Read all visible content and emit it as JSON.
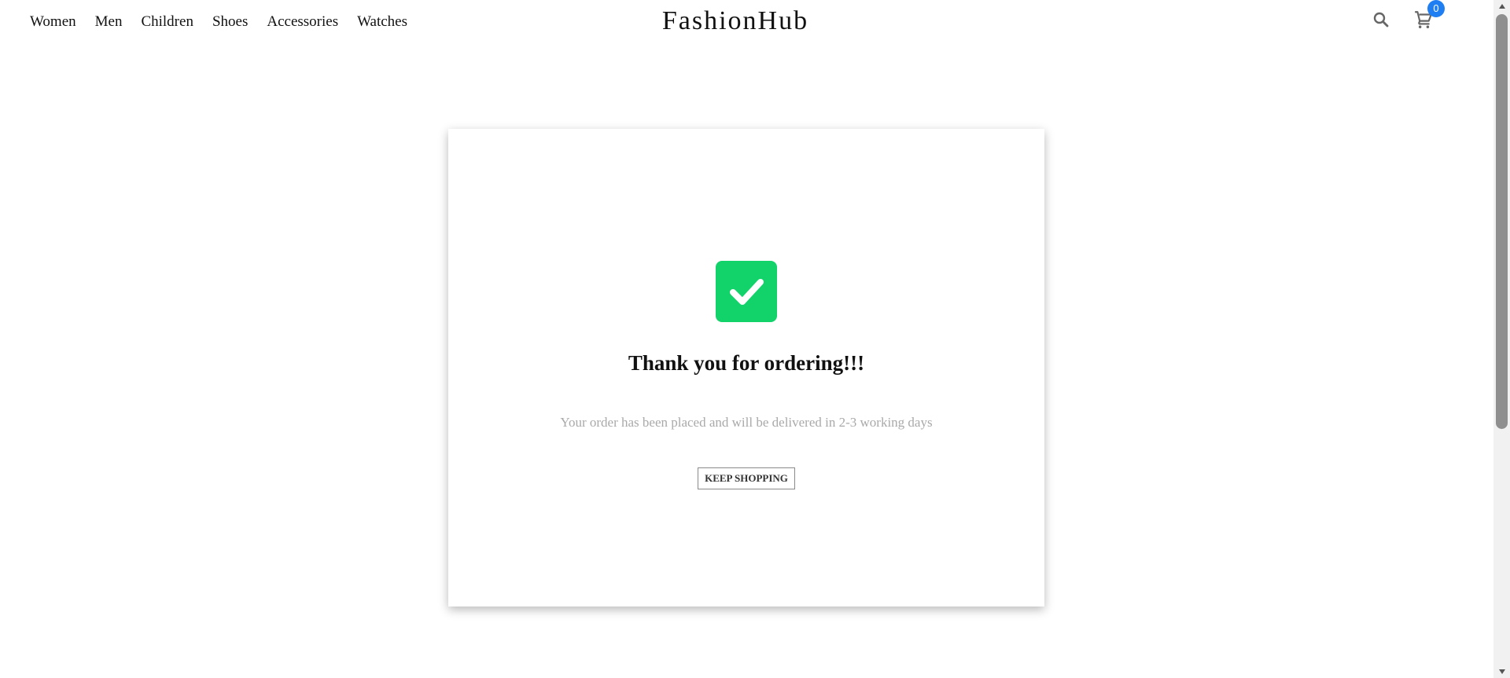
{
  "header": {
    "brand": "FashionHub",
    "nav": [
      "Women",
      "Men",
      "Children",
      "Shoes",
      "Accessories",
      "Watches"
    ],
    "icons": {
      "search": "search-icon",
      "cart": "cart-icon"
    },
    "cart_count": "0"
  },
  "confirmation": {
    "icon": "checkmark-icon",
    "title": "Thank you for ordering!!!",
    "message": "Your order has been placed and will be delivered in 2-3 working days",
    "button_label": "KEEP SHOPPING"
  },
  "colors": {
    "success": "#12d26a",
    "badge": "#1f7ef2",
    "muted_text": "#a9a9a9"
  }
}
